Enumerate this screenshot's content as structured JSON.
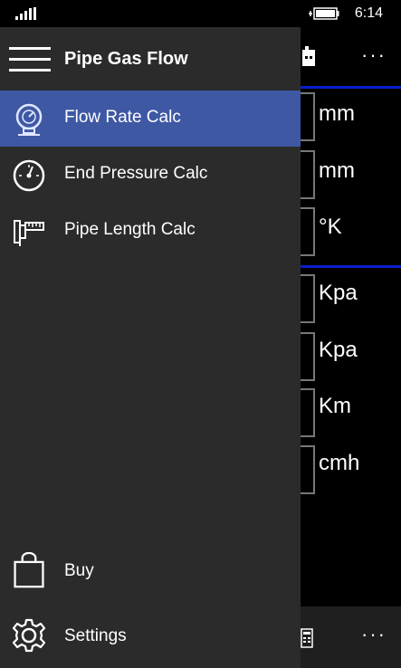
{
  "status": {
    "time": "6:14"
  },
  "drawer": {
    "title": "Pipe Gas Flow",
    "items": [
      {
        "label": "Flow Rate Calc",
        "icon": "gauge-icon",
        "selected": true
      },
      {
        "label": "End Pressure Calc",
        "icon": "pressure-dial-icon",
        "selected": false
      },
      {
        "label": "Pipe Length Calc",
        "icon": "pipe-ruler-icon",
        "selected": false
      }
    ],
    "footer": [
      {
        "label": "Buy",
        "icon": "shopping-bag-icon"
      },
      {
        "label": "Settings",
        "icon": "gear-icon"
      }
    ]
  },
  "background_page": {
    "units": [
      "mm",
      "mm",
      "°K",
      "Kpa",
      "Kpa",
      "Km",
      "cmh"
    ],
    "more_label": "···"
  },
  "colors": {
    "accent": "#3e58a4",
    "divider": "#0a1ecd",
    "drawer_bg": "#2b2b2b"
  }
}
